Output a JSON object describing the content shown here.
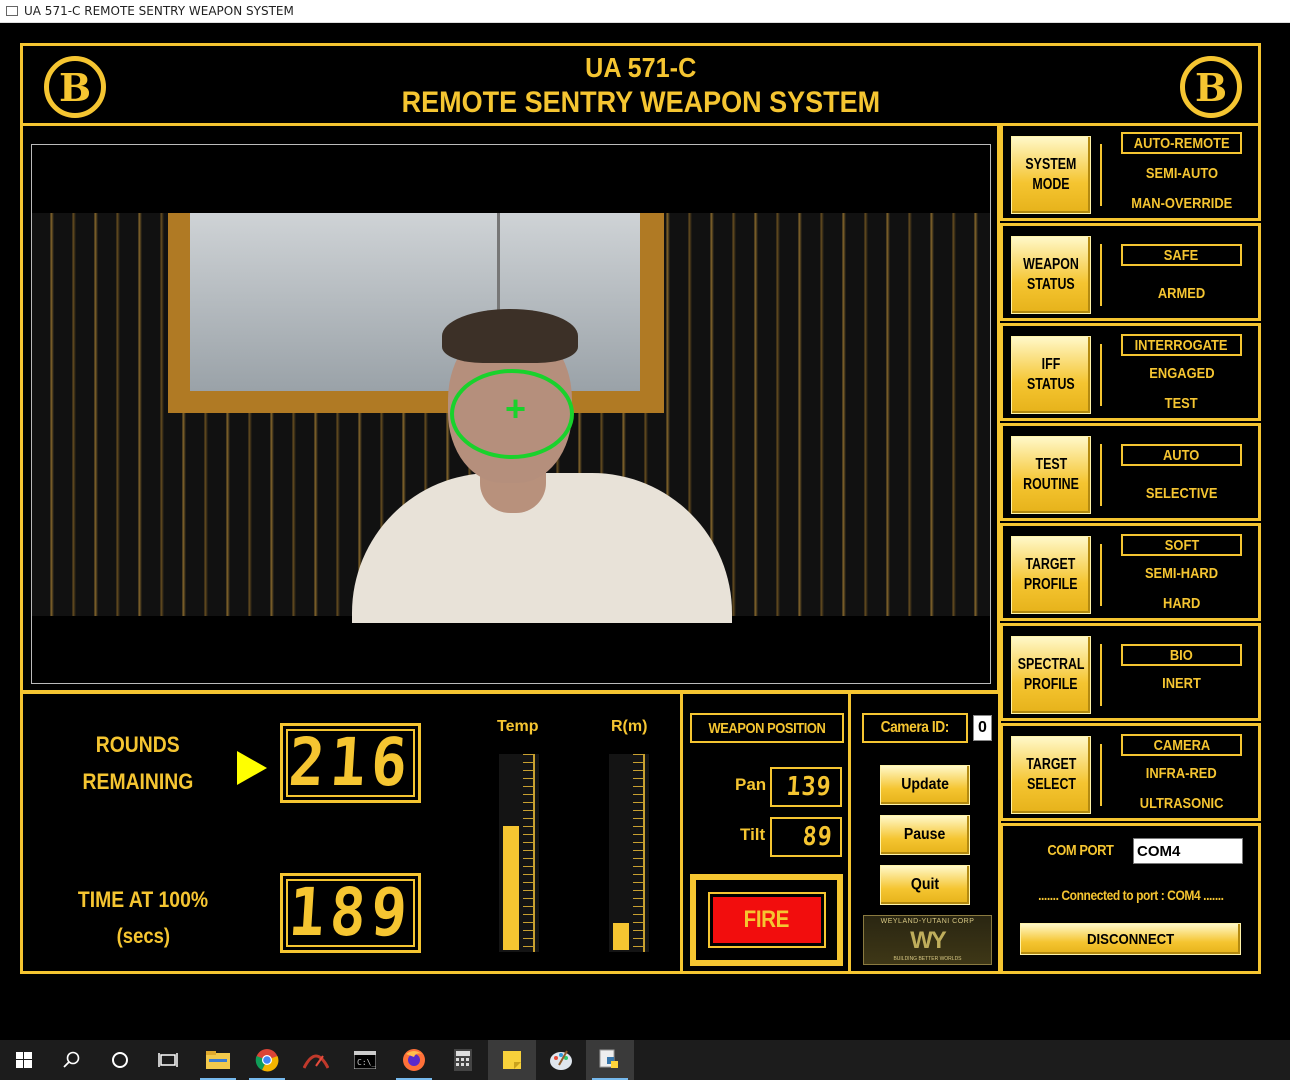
{
  "window": {
    "title": "UA 571-C REMOTE SENTRY WEAPON SYSTEM"
  },
  "header": {
    "line1": "UA 571-C",
    "line2": "REMOTE SENTRY WEAPON SYSTEM",
    "logo_letter": "B"
  },
  "rounds": {
    "label_line1": "ROUNDS",
    "label_line2": "REMAINING",
    "value": "216",
    "time_label_line1": "TIME AT 100%",
    "time_label_line2": "(secs)",
    "time_value": "189"
  },
  "gauges": {
    "temp_label": "Temp",
    "range_label": "R(m)",
    "temp_level": 0.64,
    "range_level": 0.14
  },
  "weapon_position": {
    "title": "WEAPON POSITION",
    "pan_label": "Pan",
    "pan_value": "139",
    "tilt_label": "Tilt",
    "tilt_value": "89",
    "fire_label": "FIRE"
  },
  "camera": {
    "id_label": "Camera ID:",
    "id_value": "0",
    "update_label": "Update",
    "pause_label": "Pause",
    "quit_label": "Quit",
    "logo_top": "WEYLAND-YUTANI CORP",
    "logo_mark": "WY",
    "logo_bottom": "BUILDING BETTER WORLDS"
  },
  "controls": [
    {
      "button": [
        "SYSTEM",
        "MODE"
      ],
      "options": [
        "AUTO-REMOTE",
        "SEMI-AUTO",
        "MAN-OVERRIDE"
      ],
      "selected": 0
    },
    {
      "button": [
        "WEAPON",
        "STATUS"
      ],
      "options": [
        "SAFE",
        "ARMED"
      ],
      "selected": 0
    },
    {
      "button": [
        "IFF",
        "STATUS"
      ],
      "options": [
        "INTERROGATE",
        "ENGAGED",
        "TEST"
      ],
      "selected": 0
    },
    {
      "button": [
        "TEST",
        "ROUTINE"
      ],
      "options": [
        "AUTO",
        "SELECTIVE"
      ],
      "selected": 0
    },
    {
      "button": [
        "TARGET",
        "PROFILE"
      ],
      "options": [
        "SOFT",
        "SEMI-HARD",
        "HARD"
      ],
      "selected": 0
    },
    {
      "button": [
        "SPECTRAL",
        "PROFILE"
      ],
      "options": [
        "BIO",
        "INERT"
      ],
      "selected": 0
    },
    {
      "button": [
        "TARGET",
        "SELECT"
      ],
      "options": [
        "CAMERA",
        "INFRA-RED",
        "ULTRASONIC"
      ],
      "selected": 0
    }
  ],
  "com": {
    "label": "COM PORT",
    "value": "COM4",
    "status": "....... Connected to port : COM4 .......",
    "disconnect_label": "DISCONNECT"
  },
  "colors": {
    "accent": "#f5c531",
    "fire": "#f20d0d",
    "reticle": "#19d22c"
  },
  "taskbar": {
    "icons": [
      "windows-start-icon",
      "search-icon",
      "cortana-icon",
      "task-view-icon",
      "file-explorer-icon",
      "chrome-icon",
      "app-icon",
      "terminal-icon",
      "firefox-icon",
      "calculator-icon",
      "sticky-notes-icon",
      "paint-icon",
      "python-icon"
    ]
  }
}
